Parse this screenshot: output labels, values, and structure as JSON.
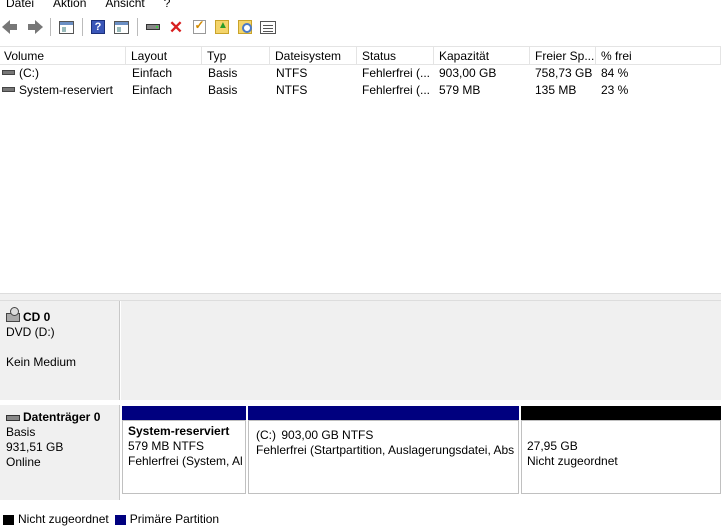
{
  "menu": [
    "Datei",
    "Aktion",
    "Ansicht",
    "?"
  ],
  "toolbar": {
    "buttons": [
      "back-icon",
      "forward-icon",
      "window-icon",
      "help-icon",
      "window-icon",
      "drive-icon",
      "delete-icon",
      "properties-icon",
      "up-folder-icon",
      "search-icon",
      "list-icon"
    ]
  },
  "volumes": {
    "columns": [
      "Volume",
      "Layout",
      "Typ",
      "Dateisystem",
      "Status",
      "Kapazität",
      "Freier Sp...",
      "% frei"
    ],
    "rows": [
      {
        "volume": "(C:)",
        "layout": "Einfach",
        "typ": "Basis",
        "fs": "NTFS",
        "status": "Fehlerfrei (...",
        "capacity": "903,00 GB",
        "free": "758,73 GB",
        "pct": "84 %"
      },
      {
        "volume": "System-reserviert",
        "layout": "Einfach",
        "typ": "Basis",
        "fs": "NTFS",
        "status": "Fehlerfrei (...",
        "capacity": "579 MB",
        "free": "135 MB",
        "pct": "23 %"
      }
    ]
  },
  "disks": {
    "cd": {
      "name": "CD 0",
      "drive": "DVD (D:)",
      "media": "Kein Medium"
    },
    "disk0": {
      "name": "Datenträger 0",
      "type": "Basis",
      "size": "931,51 GB",
      "status": "Online",
      "partitions": [
        {
          "title": "System-reserviert",
          "size": "579 MB NTFS",
          "status": "Fehlerfrei (System, Al"
        },
        {
          "title": "(C:)",
          "size": "903,00 GB NTFS",
          "status": "Fehlerfrei (Startpartition, Auslagerungsdatei, Abst"
        },
        {
          "title": "",
          "size": "27,95 GB",
          "status": "Nicht zugeordnet"
        }
      ]
    }
  },
  "legend": [
    {
      "label": "Nicht zugeordnet",
      "color": "#000000"
    },
    {
      "label": "Primäre Partition",
      "color": "#00007f"
    }
  ],
  "colors": {
    "primary": "#00007f",
    "unallocated": "#000000"
  }
}
